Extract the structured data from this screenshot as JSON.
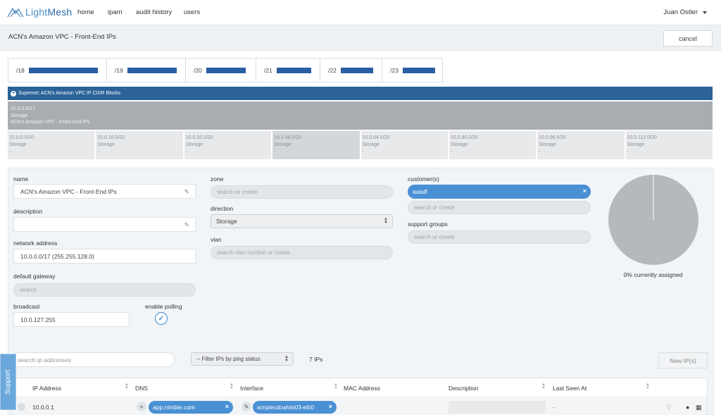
{
  "nav": {
    "logo_light": "Light",
    "logo_mesh": "Mesh",
    "links": [
      "home",
      "ipam",
      "audit history",
      "users"
    ],
    "user": "Juan Ostler"
  },
  "titlebar": {
    "title": "ACN's Amazon VPC - Front-End IPs",
    "cancel_label": "cancel"
  },
  "prefixes": [
    {
      "label": "/18",
      "fill": 1.0
    },
    {
      "label": "/19",
      "fill": 1.0
    },
    {
      "label": "/20",
      "fill": 1.0
    },
    {
      "label": "/21",
      "fill": 1.0
    },
    {
      "label": "/22",
      "fill": 1.0
    },
    {
      "label": "/23",
      "fill": 1.0
    }
  ],
  "supernet": {
    "label": "Supernet: ACN's Amazon VPC IP CIDR Blocks"
  },
  "parent_block": {
    "cidr": "10.0.0.0/17",
    "type": "Storage",
    "name": "ACN's Amazon VPC - Front-End IPs"
  },
  "subblocks": [
    {
      "cidr": "10.0.0.0/20",
      "type": "Storage",
      "name": "-"
    },
    {
      "cidr": "10.0.16.0/20",
      "type": "Storage",
      "name": "-"
    },
    {
      "cidr": "10.0.32.0/20",
      "type": "Storage",
      "name": "-"
    },
    {
      "cidr": "10.0.48.0/20",
      "type": "Storage",
      "name": "-"
    },
    {
      "cidr": "10.0.64.0/20",
      "type": "Storage",
      "name": "-"
    },
    {
      "cidr": "10.0.80.0/20",
      "type": "Storage",
      "name": "-"
    },
    {
      "cidr": "10.0.96.0/20",
      "type": "Storage",
      "name": "-"
    },
    {
      "cidr": "10.0.112.0/20",
      "type": "Storage",
      "name": "-"
    }
  ],
  "form": {
    "name_label": "name",
    "name_value": "ACN's Amazon VPC - Front-End IPs",
    "description_label": "description",
    "description_value": "",
    "network_label": "network address",
    "network_value": "10.0.0.0/17 (255.255.128.0)",
    "gateway_label": "default gateway",
    "gateway_placeholder": "search",
    "broadcast_label": "broadcast",
    "broadcast_value": "10.0.127.255",
    "polling_label": "enable polling",
    "zone_label": "zone",
    "zone_placeholder": "search or create",
    "direction_label": "direction",
    "direction_value": "Storage",
    "vlan_label": "vlan",
    "vlan_placeholder": "search vlan number or create",
    "customers_label": "customer(s)",
    "customer_tag": "aasdf",
    "customer_placeholder": "search or create",
    "support_label": "support groups",
    "support_placeholder": "search or create",
    "assigned_caption": "0% currently assigned",
    "assigned_fraction": 0.0
  },
  "ip_toolbar": {
    "search_placeholder": "search ip addresses",
    "filter_value": "-- Filter IPs by ping status",
    "count": "7 IPs",
    "new_label": "New IP(s)",
    "support_tab": "Support"
  },
  "table": {
    "columns": [
      "IP Address",
      "DNS",
      "Interface",
      "MAC Address",
      "Description",
      "Last Seen At"
    ],
    "rows": [
      {
        "ip": "10.0.0.1",
        "dns": "app.nimble.com",
        "interface": "acnpiecdcwhiis03-eth0",
        "mac": "",
        "description": "",
        "last_seen": "-"
      }
    ]
  },
  "colors": {
    "accent": "#4a90d4",
    "supernet": "#2b6399",
    "prefix_bar": "#2a5fa3",
    "pie": "#b4b9bd"
  }
}
